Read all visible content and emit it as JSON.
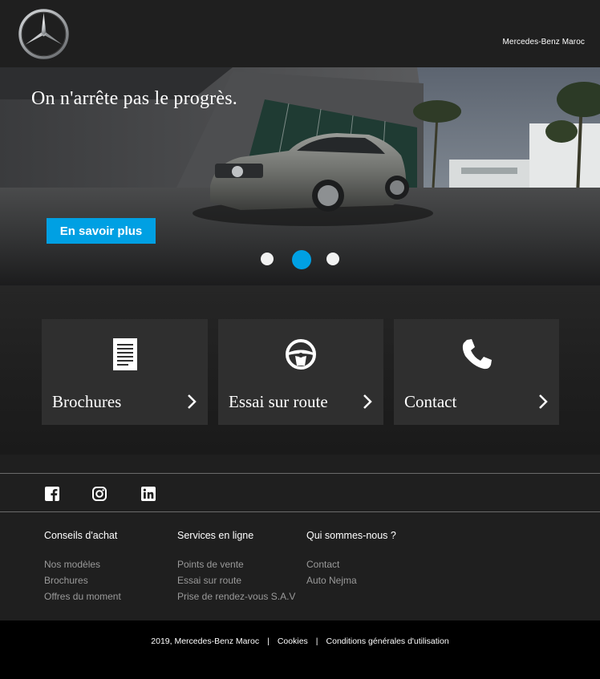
{
  "header": {
    "logo_icon": "mercedes-star-icon",
    "brand": "Mercedes-Benz Maroc"
  },
  "hero": {
    "title": "On n'arrête pas le progrès.",
    "cta_label": "En savoir plus",
    "carousel": {
      "slides": 3,
      "active_slide": 2
    },
    "accent_color": "#00a0e3"
  },
  "cards": [
    {
      "label": "Brochures",
      "icon": "document-icon"
    },
    {
      "label": "Essai sur route",
      "icon": "steering-wheel-icon"
    },
    {
      "label": "Contact",
      "icon": "phone-icon"
    }
  ],
  "social": [
    "facebook-icon",
    "instagram-icon",
    "linkedin-icon"
  ],
  "footer": {
    "columns": [
      {
        "title": "Conseils d'achat",
        "items": [
          "Nos modèles",
          "Brochures",
          "Offres du moment"
        ]
      },
      {
        "title": "Services en ligne",
        "items": [
          "Points de vente",
          "Essai sur route",
          "Prise de rendez-vous S.A.V"
        ]
      },
      {
        "title": "Qui sommes-nous ?",
        "items": [
          "Contact",
          "Auto Nejma"
        ]
      }
    ],
    "copyright": "2019, Mercedes-Benz Maroc",
    "separator": "|",
    "cookies": "Cookies",
    "terms": "Conditions générales d'utilisation"
  }
}
